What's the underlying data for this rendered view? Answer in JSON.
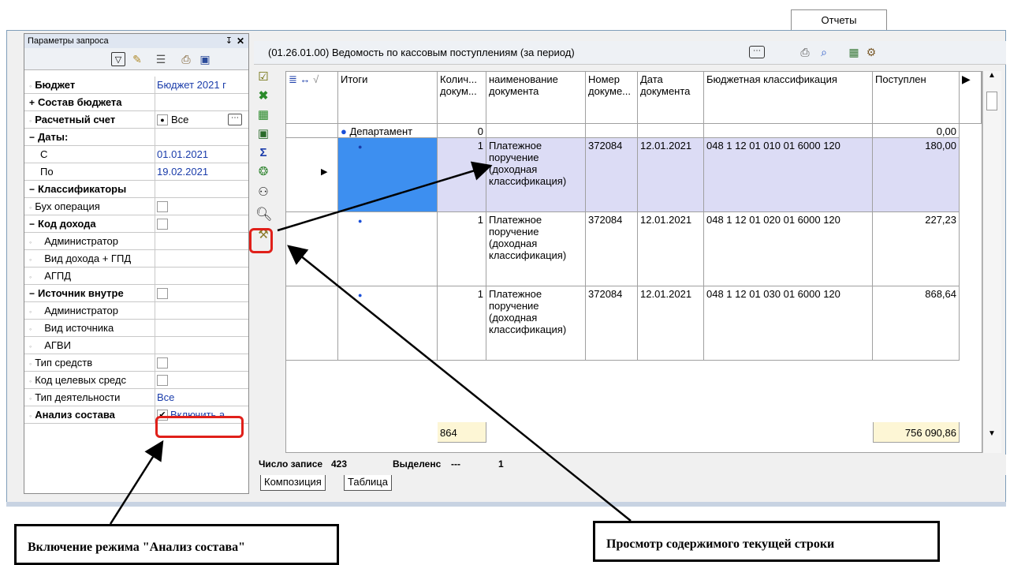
{
  "top_tab": "Отчеты",
  "left_panel": {
    "title": "Параметры запроса",
    "rows": [
      {
        "label": "Бюджет",
        "bold": true,
        "value": "Бюджет 2021 г"
      },
      {
        "label": "Состав бюджета",
        "bold": true,
        "value": ""
      },
      {
        "label": "Расчетный счет",
        "bold": true,
        "value": "Все"
      },
      {
        "label": "Даты:",
        "bold": true,
        "value": ""
      },
      {
        "label": "С",
        "bold": false,
        "value": "01.01.2021"
      },
      {
        "label": "По",
        "bold": false,
        "value": "19.02.2021"
      },
      {
        "label": "Классификаторы",
        "bold": true,
        "value": ""
      },
      {
        "label": "Бух операция",
        "bold": false,
        "value": ""
      },
      {
        "label": "Код дохода",
        "bold": true,
        "value": ""
      },
      {
        "label": "Администратор",
        "bold": false,
        "value": ""
      },
      {
        "label": "Вид дохода + ГПД",
        "bold": false,
        "value": ""
      },
      {
        "label": "АГПД",
        "bold": false,
        "value": ""
      },
      {
        "label": "Источник внутре",
        "bold": true,
        "value": ""
      },
      {
        "label": "Администратор",
        "bold": false,
        "value": ""
      },
      {
        "label": "Вид источника",
        "bold": false,
        "value": ""
      },
      {
        "label": "АГВИ",
        "bold": false,
        "value": ""
      },
      {
        "label": "Тип средств",
        "bold": false,
        "value": ""
      },
      {
        "label": "Код целевых средс",
        "bold": false,
        "value": ""
      },
      {
        "label": "Тип деятельности",
        "bold": false,
        "value": "Все"
      },
      {
        "label": "Анализ состава",
        "bold": true,
        "value": "Включить а"
      }
    ]
  },
  "report": {
    "title": "(01.26.01.00) Ведомость по кассовым поступлениям (за период)"
  },
  "grid": {
    "headers": {
      "itogi": "Итоги",
      "qty": "Колич... докум...",
      "name": "наименование документа",
      "docnum": "Номер докуме...",
      "date": "Дата документа",
      "bk": "Бюджетная классификация",
      "income": "Поступлен"
    },
    "group_row": {
      "label": "Департамент",
      "qty": "0",
      "income": "0,00"
    },
    "rows": [
      {
        "qty": "1",
        "name": "Платежное поручение (доходная классификация)",
        "docnum": "372084",
        "date": "12.01.2021",
        "bk": "048 1 12 01 010 01 6000 120",
        "income": "180,00"
      },
      {
        "qty": "1",
        "name": "Платежное поручение (доходная классификация)",
        "docnum": "372084",
        "date": "12.01.2021",
        "bk": "048 1 12 01 020 01 6000 120",
        "income": "227,23"
      },
      {
        "qty": "1",
        "name": "Платежное поручение (доходная классификация)",
        "docnum": "372084",
        "date": "12.01.2021",
        "bk": "048 1 12 01 030 01 6000 120",
        "income": "868,64"
      }
    ],
    "totals": {
      "qty": "864",
      "income": "756 090,86"
    }
  },
  "status": {
    "records_label": "Число записе",
    "records_value": "423",
    "selected_label": "Выделенс",
    "selected_value": "---",
    "extra": "1"
  },
  "bottom_tabs": [
    "Композиция",
    "Таблица"
  ],
  "callouts": {
    "left": "Включение режима \"Анализ состава\"",
    "right": "Просмотр содержимого текущей строки"
  },
  "colors": {
    "accent_red": "#e0201a",
    "selected_row": "#dcdcf5",
    "selected_cell": "#3d8ff0",
    "totals_bg": "#fdf6d5"
  }
}
